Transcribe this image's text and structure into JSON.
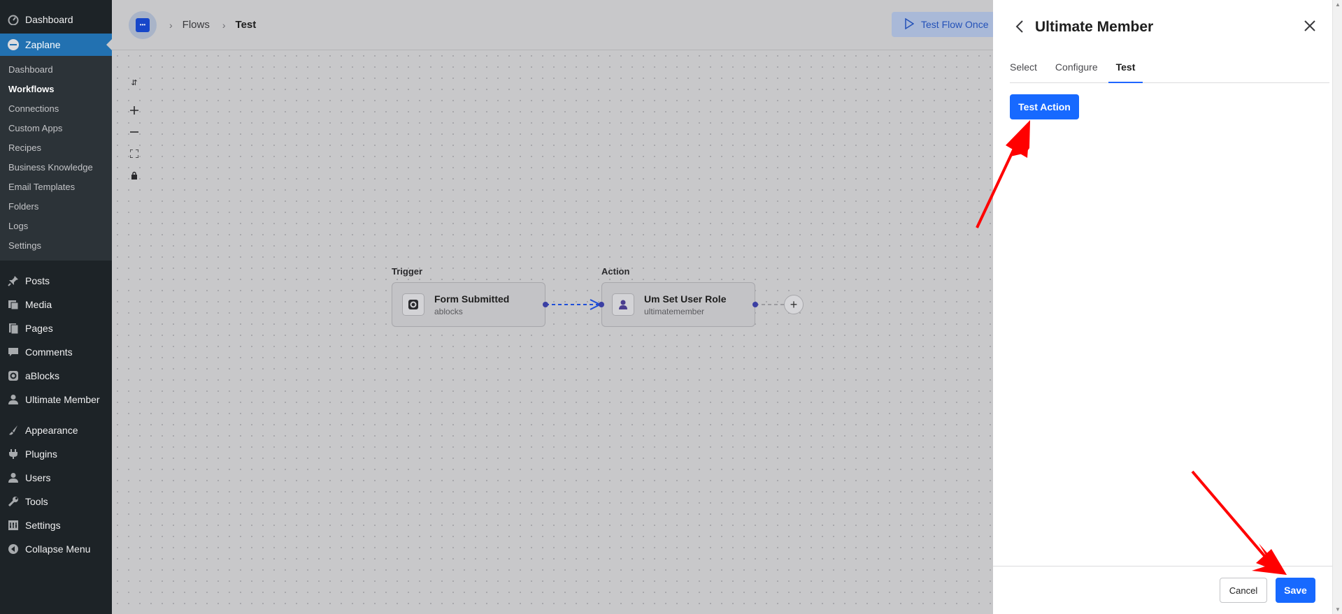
{
  "wp_sidebar": {
    "top": [
      {
        "label": "Dashboard",
        "icon": "dashboard-icon"
      },
      {
        "label": "Zaplane",
        "icon": "zaplane-icon"
      }
    ],
    "submenu": [
      "Dashboard",
      "Workflows",
      "Connections",
      "Custom Apps",
      "Recipes",
      "Business Knowledge",
      "Email Templates",
      "Folders",
      "Logs",
      "Settings"
    ],
    "current_submenu": "Workflows",
    "menu_group1": [
      {
        "label": "Posts",
        "icon": "pin-icon"
      },
      {
        "label": "Media",
        "icon": "media-icon"
      },
      {
        "label": "Pages",
        "icon": "pages-icon"
      },
      {
        "label": "Comments",
        "icon": "comments-icon"
      },
      {
        "label": "aBlocks",
        "icon": "ablocks-icon"
      },
      {
        "label": "Ultimate Member",
        "icon": "user-icon"
      }
    ],
    "menu_group2": [
      {
        "label": "Appearance",
        "icon": "brush-icon"
      },
      {
        "label": "Plugins",
        "icon": "plugin-icon"
      },
      {
        "label": "Users",
        "icon": "user-icon"
      },
      {
        "label": "Tools",
        "icon": "wrench-icon"
      },
      {
        "label": "Settings",
        "icon": "settings-icon"
      },
      {
        "label": "Collapse Menu",
        "icon": "collapse-icon"
      }
    ]
  },
  "topbar": {
    "breadcrumb": [
      "Flows",
      "Test"
    ],
    "test_flow_label": "Test Flow Once"
  },
  "canvas": {
    "trigger_label": "Trigger",
    "action_label": "Action",
    "trigger_node": {
      "title": "Form Submitted",
      "subtitle": "ablocks"
    },
    "action_node": {
      "title": "Um Set User Role",
      "subtitle": "ultimatemember"
    }
  },
  "panel": {
    "title": "Ultimate Member",
    "tabs": [
      "Select",
      "Configure",
      "Test"
    ],
    "active_tab": "Test",
    "test_action_label": "Test Action",
    "cancel_label": "Cancel",
    "save_label": "Save"
  },
  "colors": {
    "primary": "#1769ff",
    "wp_sidebar_bg": "#1d2327",
    "wp_active": "#2271b1",
    "annotation_arrow": "#ff0000"
  }
}
